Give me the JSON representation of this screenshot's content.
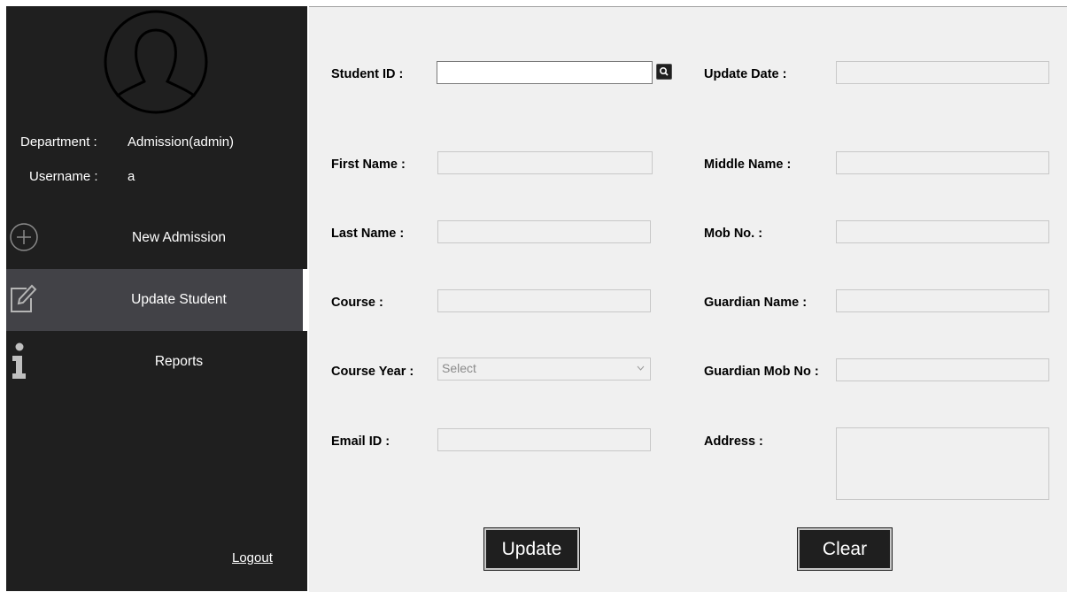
{
  "sidebar": {
    "info": {
      "department_label": "Department :",
      "department_value": "Admission(admin)",
      "username_label": "Username :",
      "username_value": "a"
    },
    "nav": [
      {
        "label": "New Admission",
        "icon": "plus-circle-icon"
      },
      {
        "label": "Update  Student",
        "icon": "edit-icon",
        "active": true
      },
      {
        "label": "Reports",
        "icon": "info-icon"
      }
    ],
    "logout_label": "Logout"
  },
  "form": {
    "labels": {
      "student_id": "Student ID :",
      "update_date": "Update Date :",
      "first_name": "First Name :",
      "middle_name": "Middle Name :",
      "last_name": "Last Name :",
      "mob_no": "Mob No. :",
      "course": "Course :",
      "guardian_name": "Guardian Name :",
      "course_year": "Course Year :",
      "guardian_mob_no": "Guardian Mob No :",
      "email_id": "Email ID :",
      "address": "Address :"
    },
    "values": {
      "student_id": "",
      "update_date": "",
      "first_name": "",
      "middle_name": "",
      "last_name": "",
      "mob_no": "",
      "course": "",
      "guardian_name": "",
      "guardian_mob_no": "",
      "email_id": "",
      "address": ""
    },
    "course_year_selected": "Select",
    "buttons": {
      "update": "Update",
      "clear": "Clear"
    }
  },
  "colors": {
    "sidebar_bg": "#1f1f1f",
    "active_nav_bg": "#424247",
    "main_bg": "#f0f0f0",
    "button_bg": "#1f1f1f"
  }
}
